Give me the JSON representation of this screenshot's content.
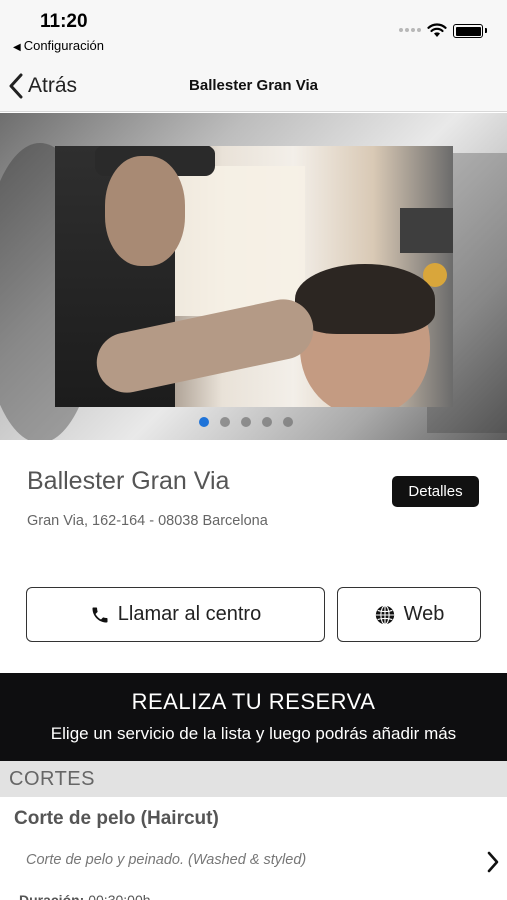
{
  "status_bar": {
    "time": "11:20",
    "back_app": "Configuración"
  },
  "nav": {
    "back_label": "Atrás",
    "title": "Ballester Gran Via"
  },
  "hero": {
    "carousel_count": 5,
    "active_index": 0
  },
  "salon": {
    "name": "Ballester Gran Via",
    "address": "Gran Via, 162-164 - 08038 Barcelona",
    "details_label": "Detalles"
  },
  "actions": {
    "call_label": "Llamar al centro",
    "web_label": "Web"
  },
  "reservation": {
    "title": "REALIZA TU RESERVA",
    "subtitle": "Elige un servicio de la lista y luego podrás añadir más"
  },
  "category": {
    "label": "CORTES"
  },
  "service": {
    "name": "Corte de pelo (Haircut)",
    "description": "Corte de pelo y peinado. (Washed & styled)",
    "duration_label": "Duración:",
    "duration_value": "00:30:00h"
  },
  "colors": {
    "accent_dot": "#1f73d8",
    "banner_bg": "#0e0e10",
    "category_bg": "#e2e2e2"
  },
  "icons": {
    "back": "chevron-left-icon",
    "call": "phone-icon",
    "web": "globe-icon",
    "service": "chevron-right-icon"
  }
}
